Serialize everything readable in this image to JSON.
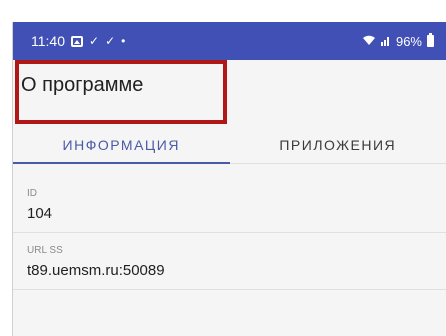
{
  "status_bar": {
    "time": "11:40",
    "icons_left": [
      "image-icon",
      "check-icon",
      "check-icon",
      "dot-icon"
    ],
    "icons_right": [
      "wifi-icon",
      "signal-icon",
      "battery-icon"
    ],
    "battery_percent": "96%",
    "color": "#4050b5"
  },
  "header": {
    "title": "О программе",
    "highlight_color": "#b01818"
  },
  "tabs": [
    {
      "label": "ИНФОРМАЦИЯ",
      "active": true
    },
    {
      "label": "ПРИЛОЖЕНИЯ",
      "active": false
    }
  ],
  "fields": [
    {
      "label": "ID",
      "value": "104"
    },
    {
      "label": "URL SS",
      "value": "t89.uemsm.ru:50089"
    }
  ],
  "accent_color": "#4a5aa8"
}
